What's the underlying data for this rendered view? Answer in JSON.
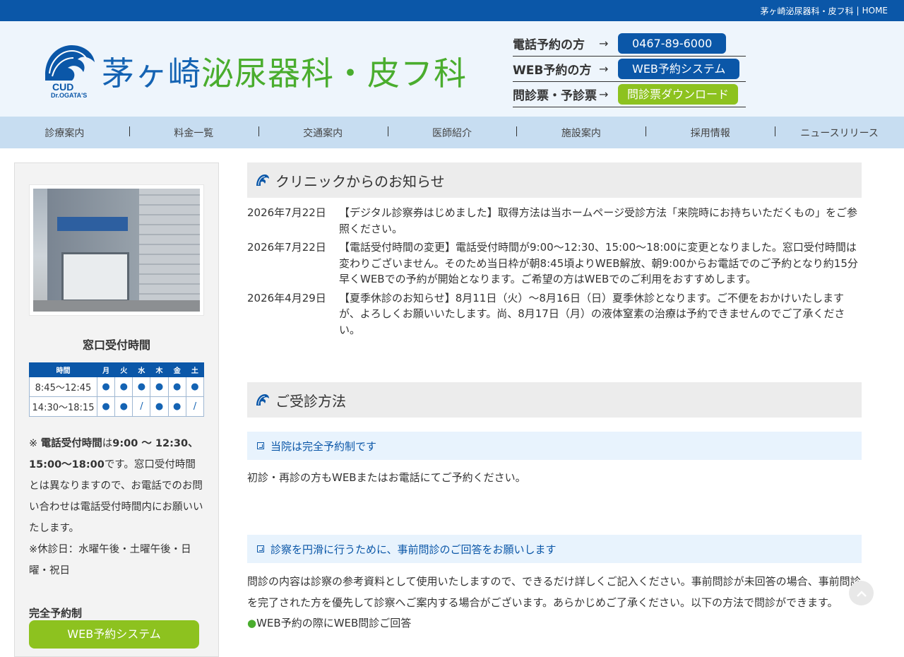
{
  "topbar": {
    "site_name": "茅ヶ崎泌尿器科・皮フ科",
    "separator": "|",
    "home": "HOME"
  },
  "logo": {
    "mark_top": "CUD",
    "mark_bottom": "Dr.OGATA'S",
    "text_blue": "茅ヶ崎",
    "text_green": "泌尿器科・皮フ科"
  },
  "contact": [
    {
      "label": "電話予約の方",
      "arrow": "→",
      "button": "0467-89-6000"
    },
    {
      "label": "WEB予約の方",
      "arrow": "→",
      "button": "WEB予約システム"
    },
    {
      "label": "問診票・予診票",
      "arrow": "→",
      "button": "問診票ダウンロード"
    }
  ],
  "nav": [
    "診療案内",
    "料金一覧",
    "交通案内",
    "医師紹介",
    "施設案内",
    "採用情報",
    "ニュースリリース"
  ],
  "sidebar": {
    "hours_title": "窓口受付時間",
    "table_headers": [
      "時間",
      "月",
      "火",
      "水",
      "木",
      "金",
      "土"
    ],
    "rows": [
      {
        "time": "8:45～12:45",
        "marks": [
          "●",
          "●",
          "●",
          "●",
          "●",
          "●"
        ]
      },
      {
        "time": "14:30～18:15",
        "marks": [
          "●",
          "●",
          "/",
          "●",
          "●",
          "/"
        ]
      }
    ],
    "note_prefix": "※",
    "note_bold1": "電話受付時間",
    "note_mid": "は",
    "note_bold2": "9:00 ～ 12:30、15:00～18:00",
    "note_rest": "です。窓口受付時間とは異なりますので、お電話でのお問い合わせは電話受付時間内にお願いいたします。",
    "closed": "※休診日：水曜午後・土曜午後・日曜・祝日",
    "reserve_title": "完全予約制",
    "reserve_button": "WEB予約システム"
  },
  "main": {
    "news_title": "クリニックからのお知らせ",
    "news": [
      {
        "date": "2026年7月22日",
        "text": "【デジタル診察券はじめました】取得方法は当ホームページ受診方法「来院時にお持ちいただくもの」をご参照ください。"
      },
      {
        "date": "2026年7月22日",
        "text": "【電話受付時間の変更】電話受付時間が9:00～12:30、15:00～18:00に変更となりました。窓口受付時間は変わりございません。そのため当日枠が朝8:45頃よりWEB解放、朝9:00からお電話でのご予約となり約15分早くWEBでの予約が開始となります。ご希望の方はWEBでのご利用をおすすめします。"
      },
      {
        "date": "2026年4月29日",
        "text": "【夏季休診のお知らせ】8月11日（火）～8月16日（日）夏季休診となります。ご不便をおかけいたしますが、よろしくお願いいたします。尚、8月17日（月）の液体窒素の治療は予約できませんのでご了承ください。"
      }
    ],
    "visit_title": "ご受診方法",
    "section1_title": "当院は完全予約制です",
    "section1_text": "初診・再診の方もWEBまたはお電話にてご予約ください。",
    "section2_title": "診察を円滑に行うために、事前問診のご回答をお願いします",
    "section2_text": "問診の内容は診察の参考資料として使用いたしますので、できるだけ詳しくご記入ください。事前問診が未回答の場合、事前問診を完了された方を優先して診察へご案内する場合がございます。あらかじめご了承ください。以下の方法で問診ができます。",
    "bullet_mark": "●",
    "bullet1": "WEB予約の際にWEB問診ご回答"
  },
  "colors": {
    "brand_blue": "#0b57a8",
    "brand_green": "#8dc21f",
    "logo_green": "#4aad2e"
  }
}
